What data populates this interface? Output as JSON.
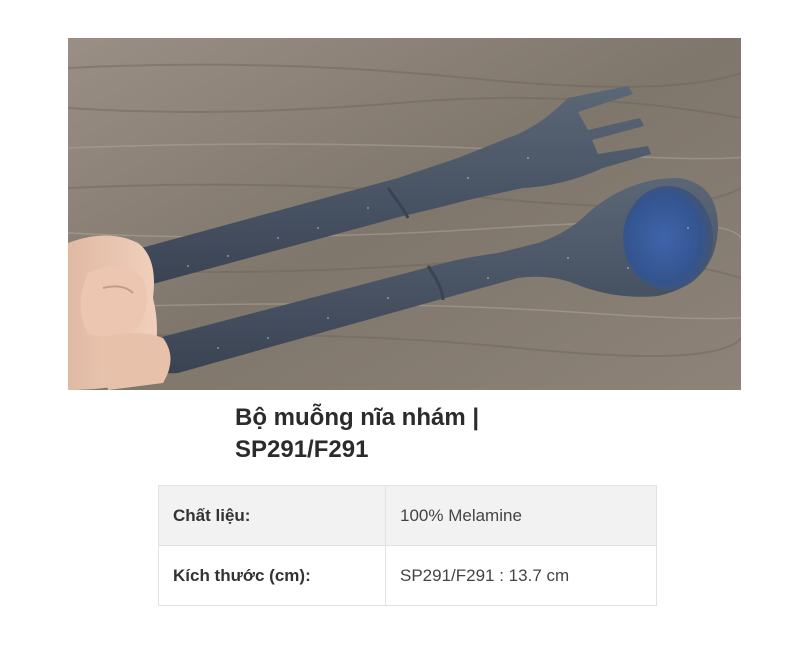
{
  "product": {
    "image_alt": "Bộ muỗng nĩa nhám",
    "title_line1": "Bộ muỗng nĩa nhám |",
    "title_line2": "SP291/F291"
  },
  "specs": {
    "rows": [
      {
        "label": "Chất liệu:",
        "value": "100% Melamine"
      },
      {
        "label": "Kích thước (cm):",
        "value": "SP291/F291 : 13.7 cm"
      }
    ]
  },
  "colors": {
    "utensil": "#4a5566",
    "spoon_bowl": "#3a5a99",
    "wood": "#8a7f74"
  }
}
